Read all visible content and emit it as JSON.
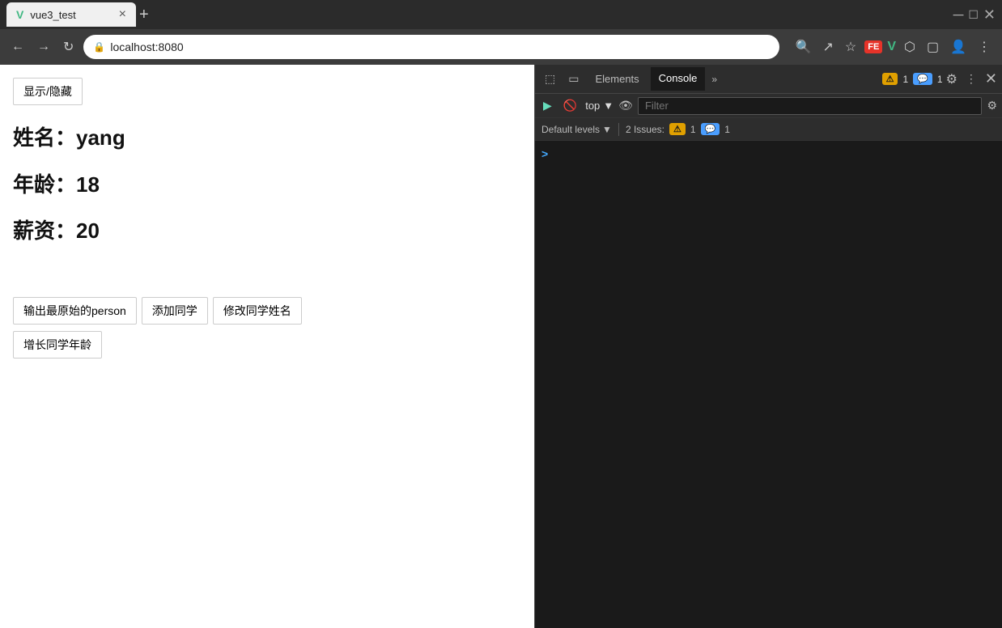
{
  "browser": {
    "tab_title": "vue3_test",
    "tab_icon": "V",
    "address": "localhost:8080",
    "new_tab_label": "+"
  },
  "devtools": {
    "panels": [
      "Elements",
      "Console"
    ],
    "active_panel": "Console",
    "issues_count": "1",
    "issues_count2": "1",
    "filter_placeholder": "Filter",
    "context_label": "top",
    "default_levels_label": "Default levels",
    "issues_label": "2 Issues:",
    "issues_warning": "1",
    "issues_info": "1"
  },
  "webpage": {
    "show_hide_btn": "显示/隐藏",
    "name_label": "姓名：",
    "name_value": "yang",
    "age_label": "年龄：",
    "age_value": "18",
    "salary_label": "薪资：",
    "salary_value": "20",
    "btn1": "输出最原始的person",
    "btn2": "添加同学",
    "btn3": "修改同学姓名",
    "btn4": "增长同学年龄"
  }
}
